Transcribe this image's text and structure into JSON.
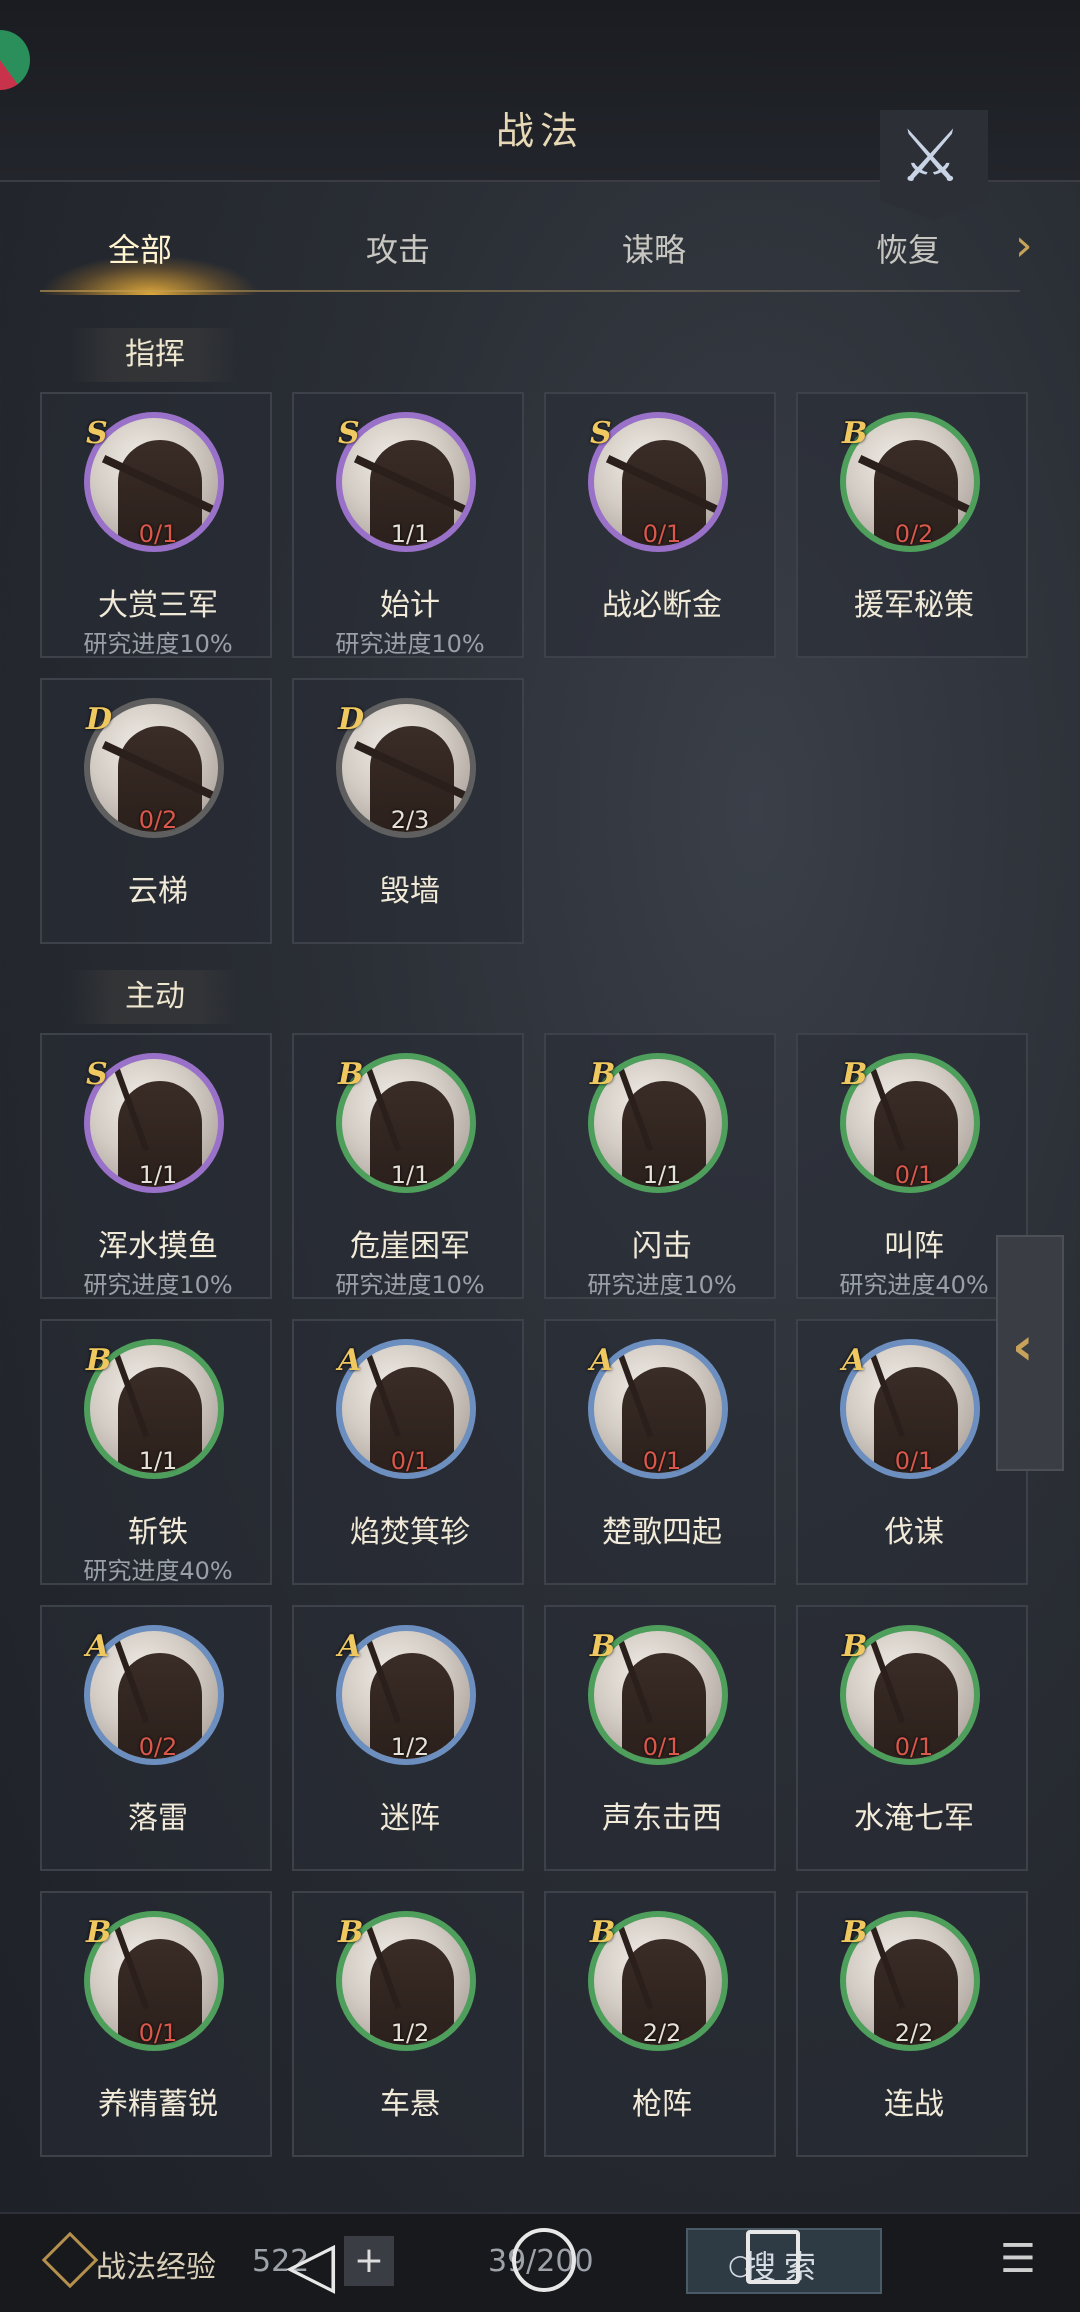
{
  "header": {
    "title": "战法"
  },
  "tabs": [
    {
      "label": "全部",
      "active": true
    },
    {
      "label": "攻击",
      "active": false
    },
    {
      "label": "谋略",
      "active": false
    },
    {
      "label": "恢复",
      "active": false
    }
  ],
  "sections": [
    {
      "label": "指挥",
      "cards": [
        {
          "grade": "S",
          "count": "0/1",
          "count_red": true,
          "name": "大赏三军",
          "progress": "研究进度10%",
          "kind": "cmd"
        },
        {
          "grade": "S",
          "count": "1/1",
          "count_red": false,
          "name": "始计",
          "progress": "研究进度10%",
          "kind": "cmd"
        },
        {
          "grade": "S",
          "count": "0/1",
          "count_red": true,
          "name": "战必断金",
          "progress": "",
          "kind": "cmd"
        },
        {
          "grade": "B",
          "count": "0/2",
          "count_red": true,
          "name": "援军秘策",
          "progress": "",
          "kind": "cmd"
        },
        {
          "grade": "D",
          "count": "0/2",
          "count_red": true,
          "name": "云梯",
          "progress": "",
          "kind": "cmd"
        },
        {
          "grade": "D",
          "count": "2/3",
          "count_red": false,
          "name": "毁墙",
          "progress": "",
          "kind": "cmd"
        }
      ]
    },
    {
      "label": "主动",
      "cards": [
        {
          "grade": "S",
          "count": "1/1",
          "count_red": false,
          "name": "浑水摸鱼",
          "progress": "研究进度10%",
          "kind": "act"
        },
        {
          "grade": "B",
          "count": "1/1",
          "count_red": false,
          "name": "危崖困军",
          "progress": "研究进度10%",
          "kind": "act"
        },
        {
          "grade": "B",
          "count": "1/1",
          "count_red": false,
          "name": "闪击",
          "progress": "研究进度10%",
          "kind": "act"
        },
        {
          "grade": "B",
          "count": "0/1",
          "count_red": true,
          "name": "叫阵",
          "progress": "研究进度40%",
          "kind": "act"
        },
        {
          "grade": "B",
          "count": "1/1",
          "count_red": false,
          "name": "斩铁",
          "progress": "研究进度40%",
          "kind": "act"
        },
        {
          "grade": "A",
          "count": "0/1",
          "count_red": true,
          "name": "焰焚箕轸",
          "progress": "",
          "kind": "act"
        },
        {
          "grade": "A",
          "count": "0/1",
          "count_red": true,
          "name": "楚歌四起",
          "progress": "",
          "kind": "act"
        },
        {
          "grade": "A",
          "count": "0/1",
          "count_red": true,
          "name": "伐谋",
          "progress": "",
          "kind": "act"
        },
        {
          "grade": "A",
          "count": "0/2",
          "count_red": true,
          "name": "落雷",
          "progress": "",
          "kind": "act"
        },
        {
          "grade": "A",
          "count": "1/2",
          "count_red": false,
          "name": "迷阵",
          "progress": "",
          "kind": "act"
        },
        {
          "grade": "B",
          "count": "0/1",
          "count_red": true,
          "name": "声东击西",
          "progress": "",
          "kind": "act"
        },
        {
          "grade": "B",
          "count": "0/1",
          "count_red": true,
          "name": "水淹七军",
          "progress": "",
          "kind": "act"
        },
        {
          "grade": "B",
          "count": "0/1",
          "count_red": true,
          "name": "养精蓄锐",
          "progress": "",
          "kind": "act"
        },
        {
          "grade": "B",
          "count": "1/2",
          "count_red": false,
          "name": "车悬",
          "progress": "",
          "kind": "act"
        },
        {
          "grade": "B",
          "count": "2/2",
          "count_red": false,
          "name": "枪阵",
          "progress": "",
          "kind": "act"
        },
        {
          "grade": "B",
          "count": "2/2",
          "count_red": false,
          "name": "连战",
          "progress": "",
          "kind": "act"
        }
      ]
    }
  ],
  "footer": {
    "exp_label": "战法经验",
    "exp_value": "522",
    "capacity": "39/200",
    "search_label": "搜索"
  },
  "icons": {
    "close": "crossed-swords-icon",
    "side_toggle": "chevron-left-icon",
    "tab_next": "chevron-right-icon",
    "list": "list-export-icon"
  },
  "colors": {
    "grade_S": "#9a71c9",
    "grade_A": "#6d8fbf",
    "grade_B": "#4e9e5c",
    "grade_D": "#5f5f5f",
    "count_red": "#d9574b"
  }
}
